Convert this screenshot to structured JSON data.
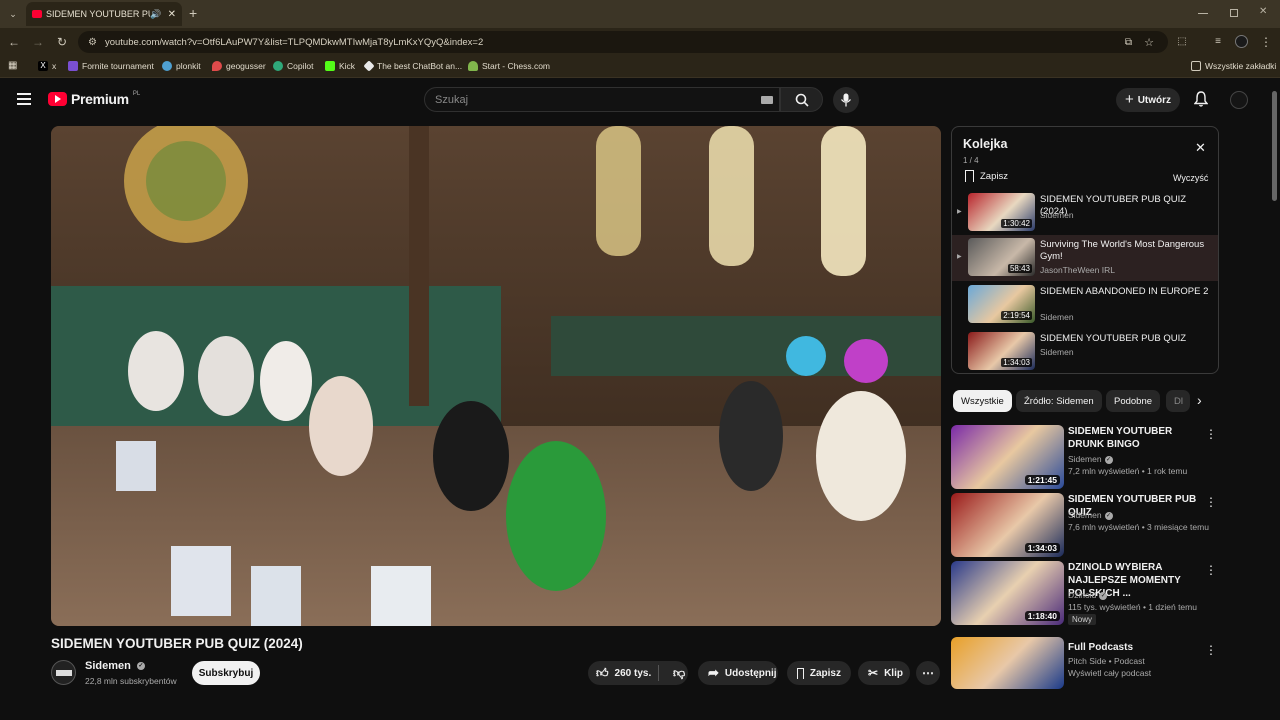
{
  "browser": {
    "tab_title": "SIDEMEN YOUTUBER PUB QUIZ",
    "url": "youtube.com/watch?v=Otf6LAuPW7Y&list=TLPQMDkwMTIwMjaT8yLmKxYQyQ&index=2",
    "bookmarks": [
      "x",
      "Fornite tournament",
      "plonkit",
      "geogusser",
      "Copilot",
      "Kick",
      "The best ChatBot an...",
      "Start - Chess.com"
    ],
    "all_bookmarks_label": "Wszystkie zakładki"
  },
  "header": {
    "logo_text": "Premium",
    "region_badge": "PL",
    "search_placeholder": "Szukaj",
    "create_label": "Utwórz"
  },
  "video": {
    "title": "SIDEMEN YOUTUBER PUB QUIZ (2024)",
    "channel": "Sidemen",
    "subscribers": "22,8 mln subskrybentów",
    "subscribe_label": "Subskrybuj",
    "likes": "260 tys.",
    "share_label": "Udostępnij",
    "save_label": "Zapisz",
    "clip_label": "Klip"
  },
  "queue": {
    "title": "Kolejka",
    "position": "1 / 4",
    "save_label": "Zapisz",
    "clear_label": "Wyczyść",
    "items": [
      {
        "title": "SIDEMEN YOUTUBER PUB QUIZ (2024)",
        "channel": "Sidemen",
        "duration": "1:30:42"
      },
      {
        "title": "Surviving The World's Most Dangerous Gym!",
        "channel": "JasonTheWeen IRL",
        "duration": "58:43"
      },
      {
        "title": "SIDEMEN ABANDONED IN EUROPE 2",
        "channel": "Sidemen",
        "duration": "2:19:54"
      },
      {
        "title": "SIDEMEN YOUTUBER PUB QUIZ",
        "channel": "Sidemen",
        "duration": "1:34:03"
      }
    ]
  },
  "chips": [
    "Wszystkie",
    "Źródło: Sidemen",
    "Podobne",
    "Dl"
  ],
  "recommendations": [
    {
      "title": "SIDEMEN YOUTUBER DRUNK BINGO",
      "channel": "Sidemen",
      "meta": "7,2 mln wyświetleń • 1 rok temu",
      "duration": "1:21:45",
      "badge": ""
    },
    {
      "title": "SIDEMEN YOUTUBER PUB QUIZ",
      "channel": "Sidemen",
      "meta": "7,6 mln wyświetleń • 3 miesiące temu",
      "duration": "1:34:03",
      "badge": ""
    },
    {
      "title": "DZINOLD WYBIERA NAJLEPSZE MOMENTY POLSKICH ...",
      "channel": "Dzinold",
      "meta": "115 tys. wyświetleń • 1 dzień temu",
      "duration": "1:18:40",
      "badge": "Nowy"
    },
    {
      "title": "Full Podcasts",
      "channel": "Pitch Side • Podcast",
      "meta": "Wyświetl cały podcast",
      "duration": "",
      "badge": ""
    }
  ],
  "colors": {
    "brand_red": "#ff0033",
    "chrome_frame": "#3c3526",
    "background": "#0f0f0f"
  }
}
